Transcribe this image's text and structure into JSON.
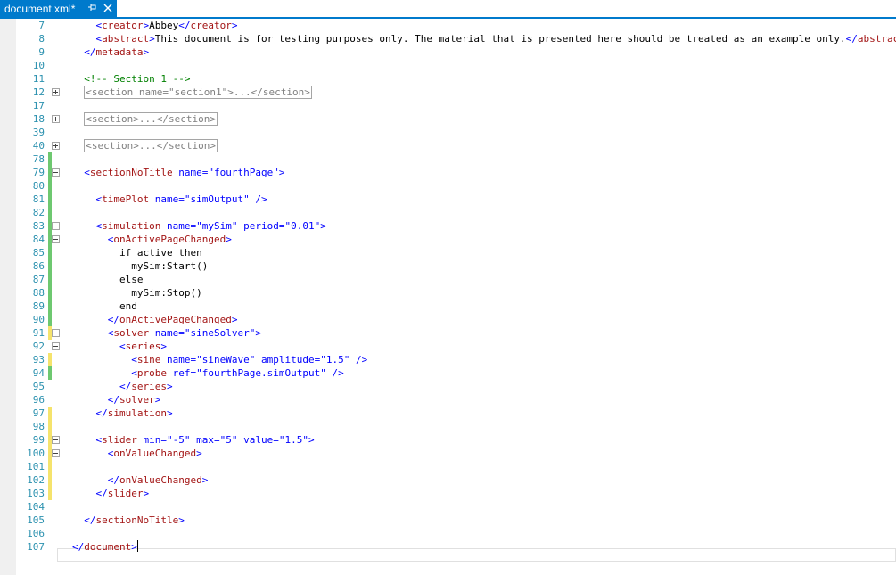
{
  "tab": {
    "title": "document.xml*",
    "pin_icon": "pin-icon",
    "close_icon": "close-icon",
    "accent": "#007acc"
  },
  "editor": {
    "lines": [
      {
        "n": "7",
        "code": "    <creator>Abbey</creator>",
        "change": "",
        "fold": ""
      },
      {
        "n": "8",
        "code": "    <abstract>This document is for testing purposes only. The material that is presented here should be treated as an example only.</abstract>",
        "change": "",
        "fold": ""
      },
      {
        "n": "9",
        "code": "  </metadata>",
        "change": "",
        "fold": ""
      },
      {
        "n": "10",
        "code": "",
        "change": "",
        "fold": ""
      },
      {
        "n": "11",
        "code": "  <!-- Section 1 -->",
        "change": "",
        "fold": ""
      },
      {
        "n": "12",
        "code": "  <section name=\"section1\">...</section>",
        "change": "",
        "fold": "plus",
        "collapsed": true
      },
      {
        "n": "17",
        "code": "",
        "change": "",
        "fold": ""
      },
      {
        "n": "18",
        "code": "  <section>...</section>",
        "change": "",
        "fold": "plus",
        "collapsed": true
      },
      {
        "n": "39",
        "code": "",
        "change": "",
        "fold": ""
      },
      {
        "n": "40",
        "code": "  <section>...</section>",
        "change": "",
        "fold": "plus",
        "collapsed": true
      },
      {
        "n": "78",
        "code": "",
        "change": "green",
        "fold": ""
      },
      {
        "n": "79",
        "code": "  <sectionNoTitle name=\"fourthPage\">",
        "change": "green",
        "fold": "minus"
      },
      {
        "n": "80",
        "code": "",
        "change": "green",
        "fold": ""
      },
      {
        "n": "81",
        "code": "    <timePlot name=\"simOutput\" />",
        "change": "green",
        "fold": ""
      },
      {
        "n": "82",
        "code": "",
        "change": "green",
        "fold": ""
      },
      {
        "n": "83",
        "code": "    <simulation name=\"mySim\" period=\"0.01\">",
        "change": "green",
        "fold": "minus"
      },
      {
        "n": "84",
        "code": "      <onActivePageChanged>",
        "change": "green",
        "fold": "minus"
      },
      {
        "n": "85",
        "code": "        if active then",
        "change": "green",
        "fold": ""
      },
      {
        "n": "86",
        "code": "          mySim:Start()",
        "change": "green",
        "fold": ""
      },
      {
        "n": "87",
        "code": "        else",
        "change": "green",
        "fold": ""
      },
      {
        "n": "88",
        "code": "          mySim:Stop()",
        "change": "green",
        "fold": ""
      },
      {
        "n": "89",
        "code": "        end",
        "change": "green",
        "fold": ""
      },
      {
        "n": "90",
        "code": "      </onActivePageChanged>",
        "change": "green",
        "fold": ""
      },
      {
        "n": "91",
        "code": "      <solver name=\"sineSolver\">",
        "change": "yellow",
        "fold": "minus"
      },
      {
        "n": "92",
        "code": "        <series>",
        "change": "",
        "fold": "minus"
      },
      {
        "n": "93",
        "code": "          <sine name=\"sineWave\" amplitude=\"1.5\" />",
        "change": "yellow",
        "fold": ""
      },
      {
        "n": "94",
        "code": "          <probe ref=\"fourthPage.simOutput\" />",
        "change": "green",
        "fold": ""
      },
      {
        "n": "95",
        "code": "        </series>",
        "change": "",
        "fold": ""
      },
      {
        "n": "96",
        "code": "      </solver>",
        "change": "",
        "fold": ""
      },
      {
        "n": "97",
        "code": "    </simulation>",
        "change": "yellow",
        "fold": ""
      },
      {
        "n": "98",
        "code": "",
        "change": "yellow",
        "fold": ""
      },
      {
        "n": "99",
        "code": "    <slider min=\"-5\" max=\"5\" value=\"1.5\">",
        "change": "yellow",
        "fold": "minus"
      },
      {
        "n": "100",
        "code": "      <onValueChanged>",
        "change": "yellow",
        "fold": "minus"
      },
      {
        "n": "101",
        "code": "",
        "change": "yellow",
        "fold": ""
      },
      {
        "n": "102",
        "code": "      </onValueChanged>",
        "change": "yellow",
        "fold": ""
      },
      {
        "n": "103",
        "code": "    </slider>",
        "change": "yellow",
        "fold": ""
      },
      {
        "n": "104",
        "code": "",
        "change": "",
        "fold": ""
      },
      {
        "n": "105",
        "code": "  </sectionNoTitle>",
        "change": "",
        "fold": ""
      },
      {
        "n": "106",
        "code": "",
        "change": "",
        "fold": ""
      },
      {
        "n": "107",
        "code": "</document>",
        "change": "",
        "fold": "",
        "caret": true
      }
    ]
  }
}
